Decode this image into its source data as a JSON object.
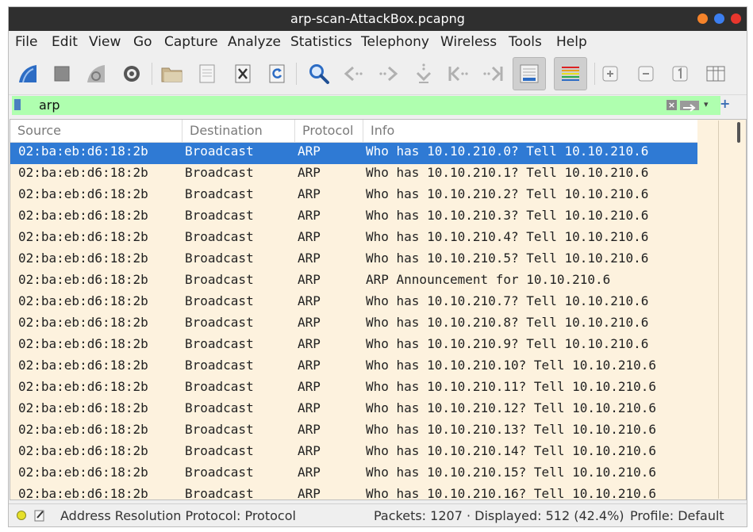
{
  "window": {
    "title": "arp-scan-AttackBox.pcapng",
    "buttons": [
      {
        "name": "minimize",
        "color": "#f5832a"
      },
      {
        "name": "maximize",
        "color": "#3c7ff0"
      },
      {
        "name": "close",
        "color": "#e8362d"
      }
    ]
  },
  "menubar": {
    "items": [
      "File",
      "Edit",
      "View",
      "Go",
      "Capture",
      "Analyze",
      "Statistics",
      "Telephony",
      "Wireless",
      "Tools",
      "Help"
    ]
  },
  "toolbar": {
    "icons": [
      "start-capture-icon",
      "stop-capture-icon",
      "restart-capture-icon",
      "capture-options-icon",
      "open-file-icon",
      "save-file-icon",
      "close-file-icon",
      "reload-file-icon",
      "find-packet-icon",
      "go-back-icon",
      "go-forward-icon",
      "go-to-packet-icon",
      "first-packet-icon",
      "last-packet-icon",
      "auto-scroll-icon",
      "colorize-icon",
      "zoom-in-icon",
      "zoom-out-icon",
      "normal-size-icon",
      "resize-columns-icon"
    ]
  },
  "filter": {
    "value": "arp",
    "background": "#afffaf"
  },
  "packet_list": {
    "columns": [
      "Source",
      "Destination",
      "Protocol",
      "Info"
    ],
    "rows": [
      {
        "source": "02:ba:eb:d6:18:2b",
        "destination": "Broadcast",
        "protocol": "ARP",
        "info": "Who has 10.10.210.0? Tell 10.10.210.6",
        "selected": true
      },
      {
        "source": "02:ba:eb:d6:18:2b",
        "destination": "Broadcast",
        "protocol": "ARP",
        "info": "Who has 10.10.210.1? Tell 10.10.210.6"
      },
      {
        "source": "02:ba:eb:d6:18:2b",
        "destination": "Broadcast",
        "protocol": "ARP",
        "info": "Who has 10.10.210.2? Tell 10.10.210.6"
      },
      {
        "source": "02:ba:eb:d6:18:2b",
        "destination": "Broadcast",
        "protocol": "ARP",
        "info": "Who has 10.10.210.3? Tell 10.10.210.6"
      },
      {
        "source": "02:ba:eb:d6:18:2b",
        "destination": "Broadcast",
        "protocol": "ARP",
        "info": "Who has 10.10.210.4? Tell 10.10.210.6"
      },
      {
        "source": "02:ba:eb:d6:18:2b",
        "destination": "Broadcast",
        "protocol": "ARP",
        "info": "Who has 10.10.210.5? Tell 10.10.210.6"
      },
      {
        "source": "02:ba:eb:d6:18:2b",
        "destination": "Broadcast",
        "protocol": "ARP",
        "info": "ARP Announcement for 10.10.210.6"
      },
      {
        "source": "02:ba:eb:d6:18:2b",
        "destination": "Broadcast",
        "protocol": "ARP",
        "info": "Who has 10.10.210.7? Tell 10.10.210.6"
      },
      {
        "source": "02:ba:eb:d6:18:2b",
        "destination": "Broadcast",
        "protocol": "ARP",
        "info": "Who has 10.10.210.8? Tell 10.10.210.6"
      },
      {
        "source": "02:ba:eb:d6:18:2b",
        "destination": "Broadcast",
        "protocol": "ARP",
        "info": "Who has 10.10.210.9? Tell 10.10.210.6"
      },
      {
        "source": "02:ba:eb:d6:18:2b",
        "destination": "Broadcast",
        "protocol": "ARP",
        "info": "Who has 10.10.210.10? Tell 10.10.210.6"
      },
      {
        "source": "02:ba:eb:d6:18:2b",
        "destination": "Broadcast",
        "protocol": "ARP",
        "info": "Who has 10.10.210.11? Tell 10.10.210.6"
      },
      {
        "source": "02:ba:eb:d6:18:2b",
        "destination": "Broadcast",
        "protocol": "ARP",
        "info": "Who has 10.10.210.12? Tell 10.10.210.6"
      },
      {
        "source": "02:ba:eb:d6:18:2b",
        "destination": "Broadcast",
        "protocol": "ARP",
        "info": "Who has 10.10.210.13? Tell 10.10.210.6"
      },
      {
        "source": "02:ba:eb:d6:18:2b",
        "destination": "Broadcast",
        "protocol": "ARP",
        "info": "Who has 10.10.210.14? Tell 10.10.210.6"
      },
      {
        "source": "02:ba:eb:d6:18:2b",
        "destination": "Broadcast",
        "protocol": "ARP",
        "info": "Who has 10.10.210.15? Tell 10.10.210.6"
      },
      {
        "source": "02:ba:eb:d6:18:2b",
        "destination": "Broadcast",
        "protocol": "ARP",
        "info": "Who has 10.10.210.16? Tell 10.10.210.6"
      }
    ]
  },
  "statusbar": {
    "expert_info": "Address Resolution Protocol: Protocol",
    "packets": "Packets: 1207 · Displayed: 512 (42.4%)",
    "profile": "Profile: Default"
  }
}
